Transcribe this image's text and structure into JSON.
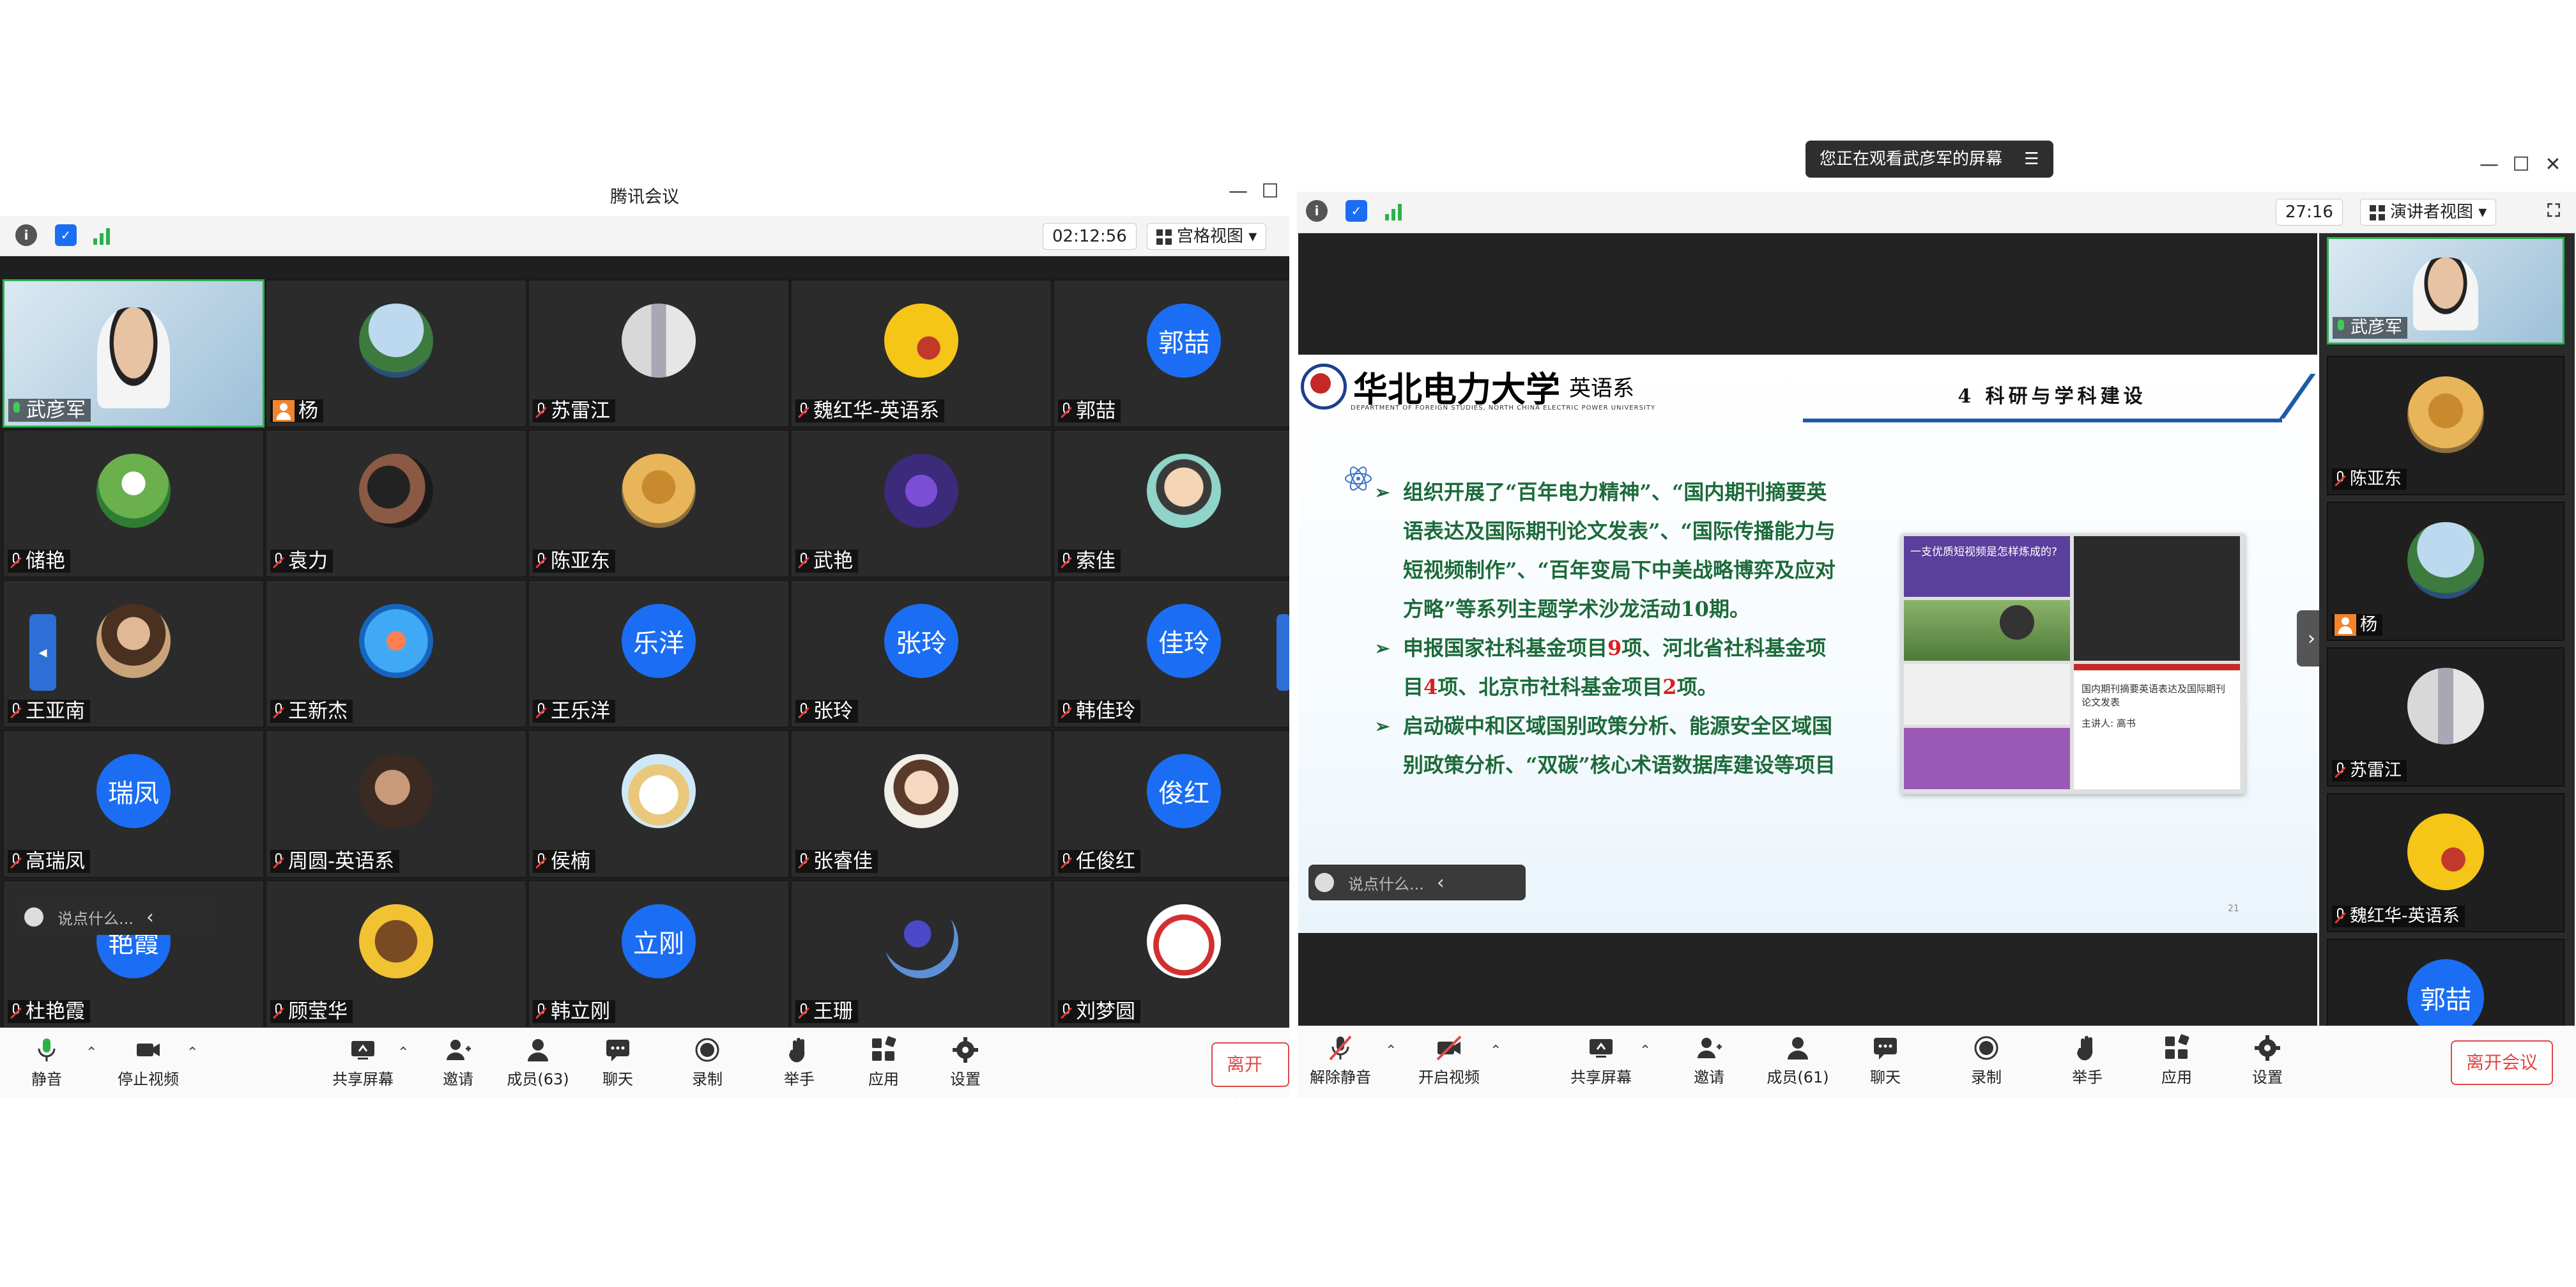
{
  "left_window": {
    "title": "腾讯会议",
    "timer": "02:12:56",
    "view_mode": "宫格视图",
    "participants": [
      {
        "name": "武彦军",
        "avatar": "video",
        "host": true
      },
      {
        "name": "杨",
        "avatar": "photo-landscape",
        "badge": "person"
      },
      {
        "name": "苏雷江",
        "avatar": "photo-building"
      },
      {
        "name": "魏红华-英语系",
        "avatar": "photo-yellow"
      },
      {
        "name": "郭喆",
        "avatar_text": "郭喆"
      },
      {
        "name": "储艳",
        "avatar": "photo-nature"
      },
      {
        "name": "袁力",
        "avatar": "photo-art"
      },
      {
        "name": "陈亚东",
        "avatar": "photo-sunset"
      },
      {
        "name": "武艳",
        "avatar": "photo-purple"
      },
      {
        "name": "索佳",
        "avatar": "photo-cartoon"
      },
      {
        "name": "王亚南",
        "avatar": "photo-woman"
      },
      {
        "name": "王新杰",
        "avatar": "photo-ocean"
      },
      {
        "name": "王乐洋",
        "avatar_text": "乐洋"
      },
      {
        "name": "张玲",
        "avatar_text": "张玲"
      },
      {
        "name": "韩佳玲",
        "avatar_text": "佳玲"
      },
      {
        "name": "高瑞凤",
        "avatar_text": "瑞凤"
      },
      {
        "name": "周圆-英语系",
        "avatar": "photo-man"
      },
      {
        "name": "侯楠",
        "avatar": "photo-bear"
      },
      {
        "name": "张睿佳",
        "avatar": "photo-girl"
      },
      {
        "name": "任俊红",
        "avatar_text": "俊红"
      },
      {
        "name": "杜艳霞",
        "avatar_text": "艳霞"
      },
      {
        "name": "顾莹华",
        "avatar": "photo-horse"
      },
      {
        "name": "韩立刚",
        "avatar_text": "立刚"
      },
      {
        "name": "王珊",
        "avatar": "photo-mermaid"
      },
      {
        "name": "刘梦圆",
        "avatar": "photo-power"
      }
    ],
    "chat_placeholder": "说点什么...",
    "toolbar": {
      "mute": "静音",
      "stop_video": "停止视频",
      "share": "共享屏幕",
      "invite": "邀请",
      "members": "成员(63)",
      "chat": "聊天",
      "record": "录制",
      "raise_hand": "举手",
      "apps": "应用",
      "settings": "设置",
      "leave": "离开会议"
    }
  },
  "right_window": {
    "banner": "您正在观看武彦军的屏幕",
    "timer": "27:16",
    "view_mode": "演讲者视图",
    "slide": {
      "logo_cn": "华北电力大学",
      "logo_dept": "英语系",
      "logo_en": "DEPARTMENT OF FOREIGN STUDIES, NORTH CHINA ELECTRIC POWER UNIVERSITY",
      "heading": "4 科研与学科建设",
      "bullet1": "组织开展了“百年电力精神”、“国内期刊摘要英语表达及国际期刊论文发表”、“国际传播能力与短视频制作”、“百年变局下中美战略博弈及应对方略”等系列主题学术沙龙活动10期。",
      "bullet2_a": "申报国家社科基金项目",
      "bullet2_n1": "9",
      "bullet2_b": "项、河北省社科基金项目",
      "bullet2_n2": "4",
      "bullet2_c": "项、北京市社科基金项目",
      "bullet2_n3": "2",
      "bullet2_d": "项。",
      "bullet3": "启动碳中和区域国别政策分析、能源安全区域国别政策分析、“双碳”核心术语数据库建设等项目",
      "collage_text1": "一支优质短视频是怎样炼成的?",
      "collage_text2": "国内期刊摘要英语表达及国际期刊论文发表",
      "collage_text3": "主讲人: 高书",
      "page_number": "21"
    },
    "rail": [
      {
        "name": "武彦军",
        "avatar": "video",
        "host": true
      },
      {
        "name": "陈亚东",
        "avatar": "photo-sunset"
      },
      {
        "name": "杨",
        "avatar": "photo-landscape",
        "badge": "person"
      },
      {
        "name": "苏雷江",
        "avatar": "photo-building"
      },
      {
        "name": "魏红华-英语系",
        "avatar": "photo-yellow"
      },
      {
        "name": "",
        "avatar_text": "郭喆"
      }
    ],
    "chat_placeholder": "说点什么...",
    "toolbar": {
      "unmute": "解除静音",
      "start_video": "开启视频",
      "share": "共享屏幕",
      "invite": "邀请",
      "members": "成员(61)",
      "chat": "聊天",
      "record": "录制",
      "raise_hand": "举手",
      "apps": "应用",
      "settings": "设置",
      "leave": "离开会议"
    }
  },
  "colors": {
    "accent_blue": "#1b6ef3",
    "leave_red": "#e04848",
    "slide_green": "#1c6a3a",
    "slide_red": "#d82020",
    "host_border": "#29b24a"
  }
}
